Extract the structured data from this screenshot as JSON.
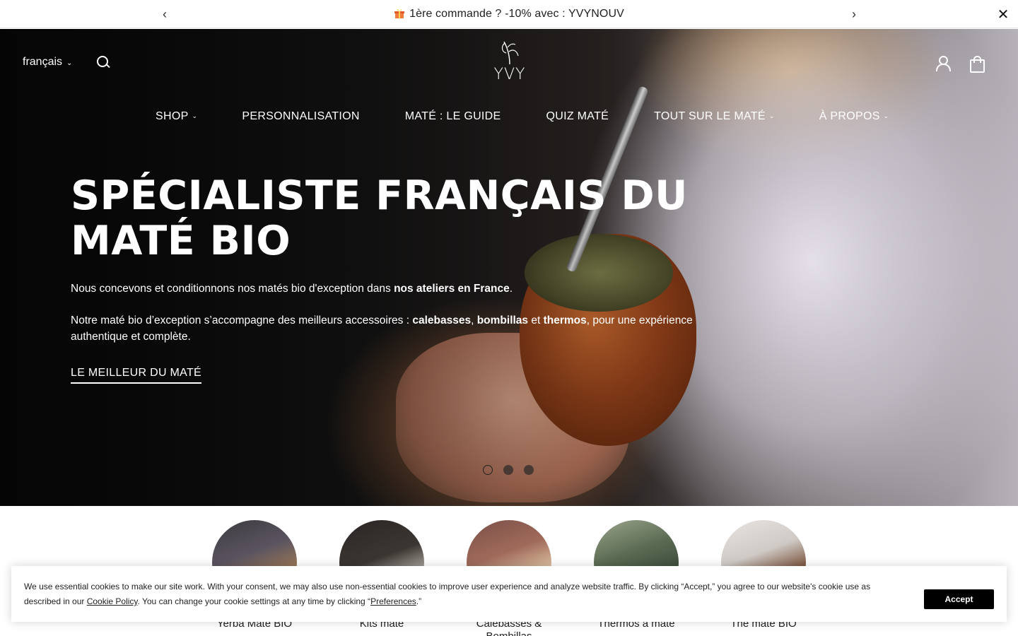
{
  "announcement": {
    "message": "1ère commande ? -10% avec : YVYNOUV",
    "prev_icon": "chevron-left-icon",
    "next_icon": "chevron-right-icon",
    "close_icon": "close-icon",
    "gift_icon": "gift-icon"
  },
  "header": {
    "language": "français",
    "logo_text": "YVY",
    "icons": [
      "search-icon",
      "user-icon",
      "shopping-bag-icon"
    ]
  },
  "nav": {
    "items": [
      {
        "label": "SHOP",
        "has_dropdown": true
      },
      {
        "label": "PERSONNALISATION",
        "has_dropdown": false
      },
      {
        "label": "MATÉ : LE GUIDE",
        "has_dropdown": false
      },
      {
        "label": "QUIZ MATÉ",
        "has_dropdown": false
      },
      {
        "label": "TOUT SUR LE MATÉ",
        "has_dropdown": true
      },
      {
        "label": "À PROPOS",
        "has_dropdown": true
      }
    ]
  },
  "hero": {
    "headline_line1": "SPÉCIALISTE FRANÇAIS DU",
    "headline_line2": "MATÉ BIO",
    "para1_pre": "Nous concevons et conditionnons nos matés bio d'exception dans ",
    "para1_bold": "nos ateliers en France",
    "para1_post": ".",
    "para2_pre": "Notre maté bio d’exception s’accompagne des meilleurs accessoires : ",
    "para2_b1": "calebasses",
    "para2_sep1": ", ",
    "para2_b2": "bombillas",
    "para2_sep2": " et ",
    "para2_b3": "thermos",
    "para2_post": ", pour une expérience authentique et complète.",
    "cta_label": "LE MEILLEUR DU MATÉ",
    "slides_count": 3,
    "active_slide": 1
  },
  "categories": [
    {
      "label": "Yerba Maté BIO",
      "colors": [
        "#3c3a3e",
        "#a07a55"
      ]
    },
    {
      "label": "Kits maté",
      "colors": [
        "#2a2624",
        "#c9c4bd"
      ]
    },
    {
      "label": "Calebasses & Bombillas",
      "colors": [
        "#7a5048",
        "#e2c9a8"
      ]
    },
    {
      "label": "Thermos à maté",
      "colors": [
        "#3c4a3a",
        "#9aa58c"
      ]
    },
    {
      "label": "Thé maté BIO",
      "colors": [
        "#cfcac6",
        "#6a3a20"
      ]
    }
  ],
  "cookie": {
    "text_pre": "We use essential cookies to make our site work. With your consent, we may also use non-essential cookies to improve user experience and analyze website traffic. By clicking “Accept,” you agree to our website's cookie use as described in our ",
    "policy_link": "Cookie Policy",
    "text_mid": ". You can change your cookie settings at any time by clicking “",
    "prefs_link": "Preferences",
    "text_post": ".”",
    "accept_label": "Accept"
  }
}
